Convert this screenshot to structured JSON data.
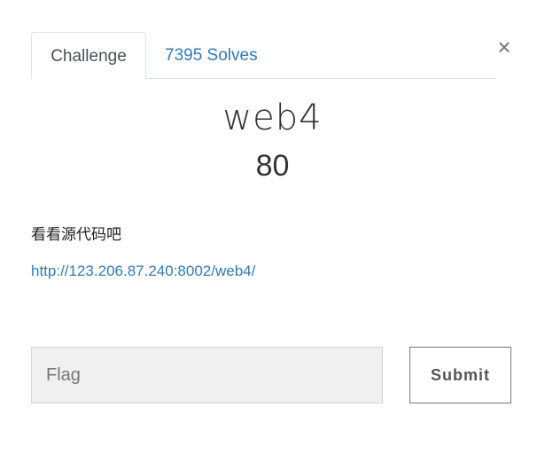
{
  "tabs": {
    "challenge_label": "Challenge",
    "solves_label": "7395 Solves"
  },
  "close_symbol": "×",
  "challenge": {
    "name": "web4",
    "value": "80",
    "description": "看看源代码吧",
    "link": "http://123.206.87.240:8002/web4/"
  },
  "form": {
    "flag_placeholder": "Flag",
    "submit_label": "Submit"
  },
  "colors": {
    "link": "#337ab7",
    "input_bg": "#f0f0f0"
  }
}
